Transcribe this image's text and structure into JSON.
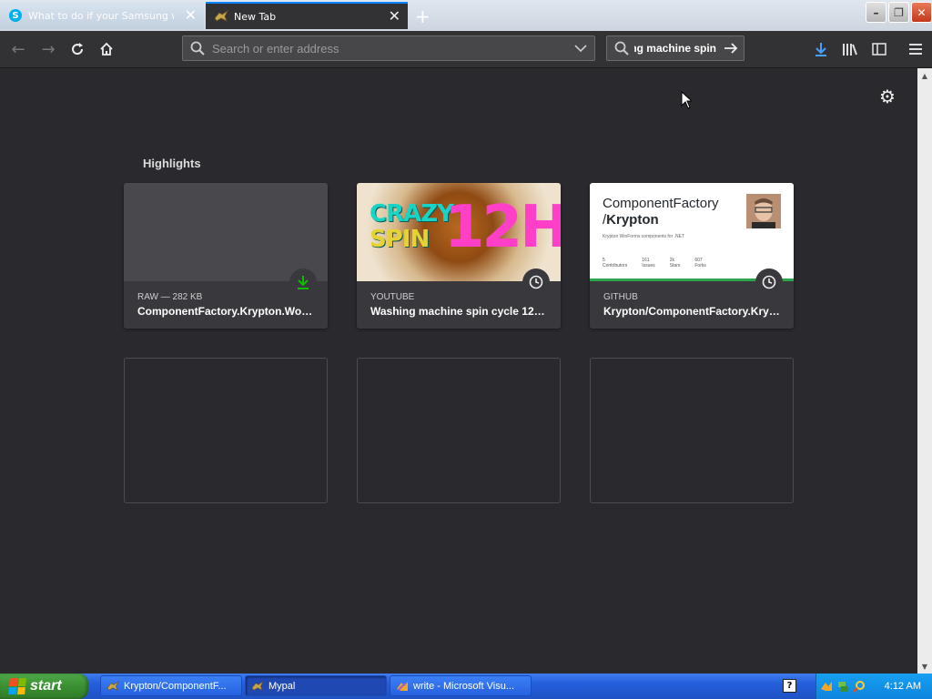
{
  "tabs": [
    {
      "title": "What to do if your Samsung wash",
      "icon": "skype-icon",
      "active": false
    },
    {
      "title": "New Tab",
      "icon": "mypal-icon",
      "active": true
    }
  ],
  "toolbar": {
    "url_placeholder": "Search or enter address",
    "url_value": "",
    "search_value": "washing machine spin"
  },
  "highlights": {
    "section_title": "Highlights",
    "cards": [
      {
        "meta": "RAW — 282 KB",
        "title": "ComponentFactory.Krypton.Wor…",
        "badge": "download-icon",
        "thumb": "blank"
      },
      {
        "meta": "YOUTUBE",
        "title": "Washing machine spin cycle 12…",
        "badge": "history-icon",
        "thumb": "video",
        "thumb_text_1": "CRAZY",
        "thumb_text_2": "SPIN",
        "thumb_text_3": "12H"
      },
      {
        "meta": "GITHUB",
        "title": "Krypton/ComponentFactory.Kry…",
        "badge": "history-icon",
        "thumb": "github",
        "gh_line1": "ComponentFactory",
        "gh_line2_prefix": "/",
        "gh_line2_bold": "Krypton",
        "gh_desc": "Krypton WinForms components for .NET",
        "gh_stats": [
          {
            "value": "5",
            "label": "Contributors"
          },
          {
            "value": "161",
            "label": "Issues"
          },
          {
            "value": "2k",
            "label": "Stars"
          },
          {
            "value": "607",
            "label": "Forks"
          }
        ]
      }
    ]
  },
  "taskbar": {
    "start_label": "start",
    "buttons": [
      {
        "label": "Krypton/ComponentF...",
        "active": false
      },
      {
        "label": "Mypal",
        "active": true
      },
      {
        "label": "write - Microsoft Visu...",
        "active": false
      }
    ],
    "help_label": "?",
    "clock": "4:12 AM"
  },
  "colors": {
    "accent": "#0a84ff",
    "download_green": "#12bc00",
    "bg": "#2a2a2e"
  }
}
